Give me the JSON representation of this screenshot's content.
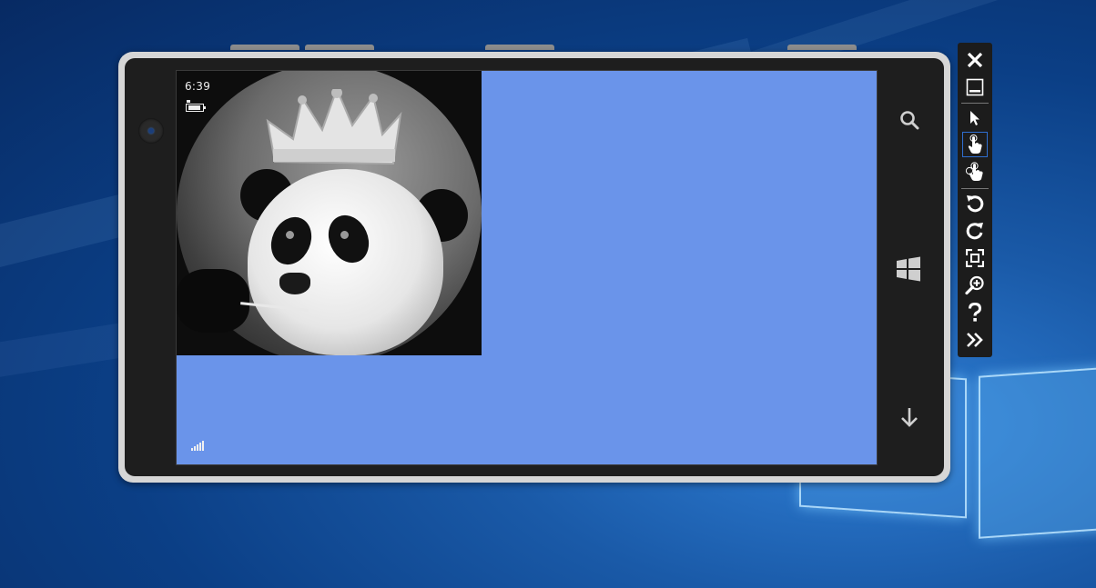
{
  "phone": {
    "status_time": "6:39",
    "screen_color": "#6a94ea"
  },
  "hardware_keys": [
    "search-icon",
    "windows-start-icon",
    "back-arrow-icon"
  ],
  "toolbar": {
    "tools": [
      {
        "name": "close-icon"
      },
      {
        "name": "minimize-icon"
      },
      {
        "name": "mouse-input-icon"
      },
      {
        "name": "single-point-touch-icon",
        "selected": true
      },
      {
        "name": "multi-point-touch-icon"
      },
      {
        "name": "rotate-left-icon"
      },
      {
        "name": "rotate-right-icon"
      },
      {
        "name": "fit-to-screen-icon"
      },
      {
        "name": "zoom-icon"
      },
      {
        "name": "help-icon"
      },
      {
        "name": "additional-tools-icon"
      }
    ],
    "accent_color": "#2f6fd1"
  }
}
